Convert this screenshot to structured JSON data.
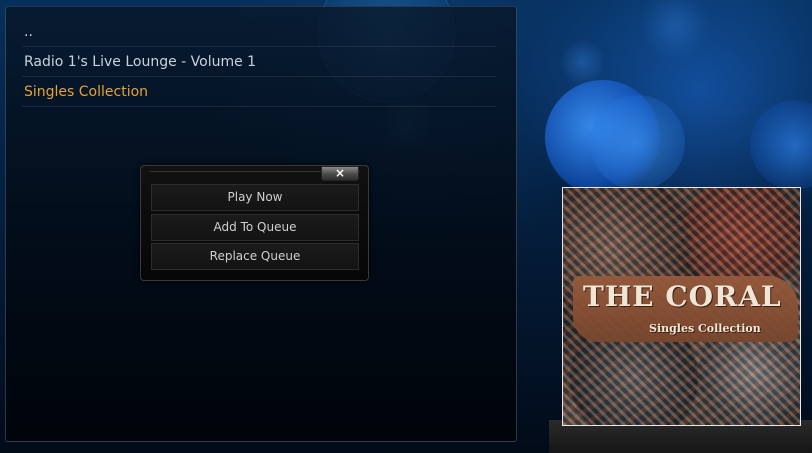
{
  "file_list": {
    "items": [
      {
        "label": ".."
      },
      {
        "label": "Radio 1's Live Lounge - Volume 1"
      },
      {
        "label": "Singles Collection",
        "selected": true
      }
    ]
  },
  "context_menu": {
    "close_label": "×",
    "options": [
      {
        "label": "Play Now"
      },
      {
        "label": "Add To Queue"
      },
      {
        "label": "Replace Queue"
      }
    ]
  },
  "album_cover": {
    "band_name": "THE CORAL",
    "album_title": "Singles Collection"
  },
  "colors": {
    "selected_text": "#e8a23a",
    "normal_text": "#c9d2dc",
    "background_blue": "#06305c"
  }
}
